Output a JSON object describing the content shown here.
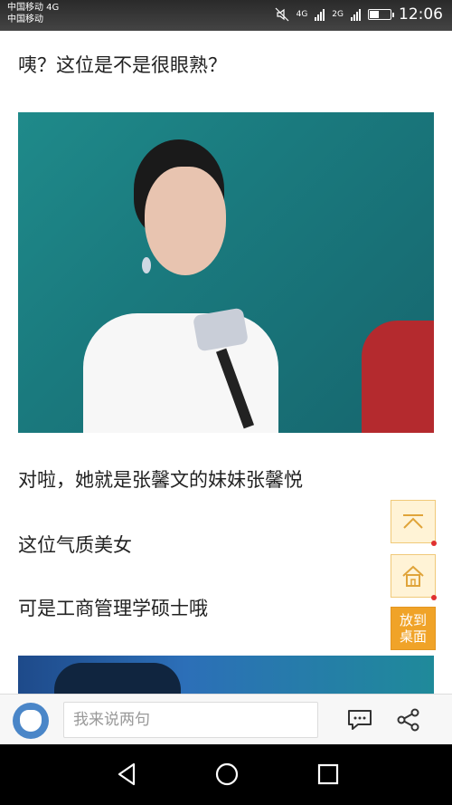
{
  "status_bar": {
    "carrier_line1": "中国移动 4G",
    "carrier_line2": "中国移动",
    "network1": "4G",
    "network2": "2G",
    "time": "12:06",
    "battery_level": 0.4
  },
  "article": {
    "para1": "咦？这位是不是很眼熟？",
    "para2": "对啦，她就是张馨文的妹妹张馨悦",
    "para3": "这位气质美女",
    "para4": "可是工商管理学硕士哦"
  },
  "side_buttons": {
    "scroll_top_icon": "chevron-up-icon",
    "home_icon": "home-icon",
    "desktop_label_line1": "放到",
    "desktop_label_line2": "桌面"
  },
  "comment_bar": {
    "placeholder": "我来说两句",
    "avatar_icon": "user-avatar",
    "comment_icon": "comment-icon",
    "share_icon": "share-icon"
  },
  "nav_bar": {
    "back_icon": "back-triangle-icon",
    "home_icon": "home-circle-icon",
    "recent_icon": "recent-square-icon"
  },
  "colors": {
    "accent_orange": "#f0a328",
    "side_button_bg": "#fff3d6",
    "notification_dot": "#e03030"
  }
}
